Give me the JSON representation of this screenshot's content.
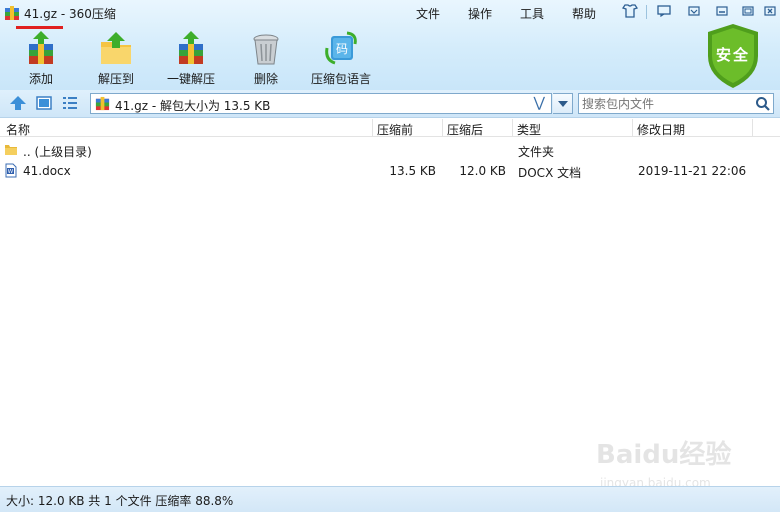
{
  "window": {
    "title": "41.gz - 360压缩",
    "menu": [
      "文件",
      "操作",
      "工具",
      "帮助"
    ]
  },
  "toolbar": {
    "buttons": [
      {
        "label": "添加",
        "icon": "add-archive-icon"
      },
      {
        "label": "解压到",
        "icon": "extract-to-icon"
      },
      {
        "label": "一键解压",
        "icon": "one-click-extract-icon"
      },
      {
        "label": "删除",
        "icon": "delete-icon"
      },
      {
        "label": "压缩包语言",
        "icon": "archive-language-icon"
      }
    ],
    "security_badge": "安全"
  },
  "address": {
    "path": "41.gz - 解包大小为 13.5 KB"
  },
  "search": {
    "placeholder": "搜索包内文件"
  },
  "columns": [
    "名称",
    "压缩前",
    "压缩后",
    "类型",
    "修改日期"
  ],
  "files": [
    {
      "name": ".. (上级目录)",
      "before": "",
      "after": "",
      "type": "文件夹",
      "date": "",
      "icon": "folder-icon"
    },
    {
      "name": "41.docx",
      "before": "13.5 KB",
      "after": "12.0 KB",
      "type": "DOCX 文档",
      "date": "2019-11-21 22:06",
      "icon": "word-document-icon"
    }
  ],
  "status": {
    "text": "大小: 12.0 KB 共 1 个文件 压缩率 88.8%"
  },
  "watermark": {
    "main": "Baidu经验",
    "sub": "jingyan.baidu.com"
  },
  "colors": {
    "header_bg": "#d4ecfb",
    "security_green": "#5aaa1e",
    "underline_red": "#e02020"
  }
}
